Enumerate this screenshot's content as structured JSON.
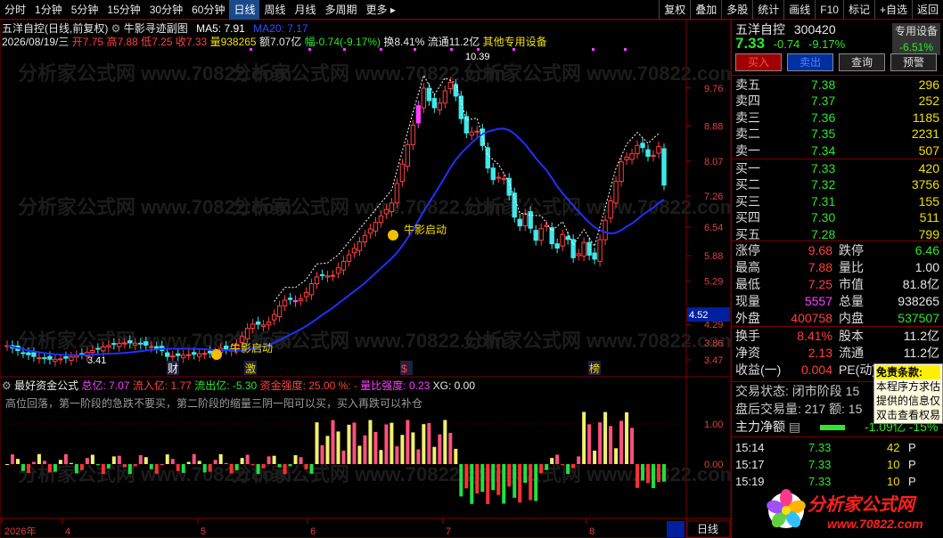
{
  "toolbar": {
    "left": [
      "分时",
      "1分钟",
      "5分钟",
      "15分钟",
      "30分钟",
      "60分钟",
      "日线",
      "周线",
      "月线",
      "多周期",
      "更多 ▸"
    ],
    "right": [
      "复权",
      "叠加",
      "多股",
      "统计",
      "画线",
      "F10",
      "标记",
      "+自选",
      "返回"
    ],
    "active": "日线"
  },
  "header": {
    "title": "五洋自控(日线,前复权)",
    "indicator_name": "牛影寻迹副图",
    "ma5": "MA5: 7.91",
    "ma20": "MA20: 7.17",
    "info_date": "2026/08/19/三",
    "info_open": "开7.75",
    "info_high": "高7.88",
    "info_low": "低7.25",
    "info_close": "收7.33",
    "info_vol": "量938265",
    "info_amt": "额7.07亿",
    "info_chg": "幅-0.74(-9.17%)",
    "info_turn": "换8.41%",
    "info_float": "流通11.2亿",
    "info_tag": "其他专用设备"
  },
  "price_axis": [
    "9.76",
    "8.88",
    "8.07",
    "7.26",
    "6.54",
    "5.88",
    "5.29",
    "4.29",
    "3.86",
    "3.47"
  ],
  "current_price_tag": "4.52",
  "annotations": {
    "high": "10.39",
    "low": "3.41",
    "signal1": "牛影启动",
    "signal2": "牛影启动",
    "events": [
      "财",
      "激",
      "$",
      "榜"
    ]
  },
  "sub": {
    "name": "最好资金公式",
    "total": "总亿: 7.07",
    "inflow": "流入亿: 1.77",
    "outflow": "流出亿: -5.30",
    "strength": "资金强度: 25.00 %: -",
    "vol_ratio": "量比强度: 0.23",
    "xg": "XG: 0.00",
    "note": "高位回落，第一阶段的急跌不要买，第二阶段的缩量三阴一阳可以买，买入再跌可以补仓",
    "axis": [
      "1.00",
      "0.00"
    ]
  },
  "date_axis": [
    "2026年",
    "4",
    "5",
    "6",
    "7",
    "8"
  ],
  "period_label": "日线",
  "watermark": "分析家公式网 www.70822.com",
  "side": {
    "name": "五洋自控",
    "code": "300420",
    "sector_badge": "专用设备",
    "price": "7.33",
    "change": "-0.74",
    "change_pct": "-9.17%",
    "sector_pct": "-6.51%",
    "buttons": [
      "买入",
      "卖出",
      "查询",
      "预警"
    ],
    "asks": [
      {
        "label": "卖五",
        "price": "7.38",
        "vol": "296"
      },
      {
        "label": "卖四",
        "price": "7.37",
        "vol": "252"
      },
      {
        "label": "卖三",
        "price": "7.36",
        "vol": "1185"
      },
      {
        "label": "卖二",
        "price": "7.35",
        "vol": "2231"
      },
      {
        "label": "卖一",
        "price": "7.34",
        "vol": "507"
      }
    ],
    "bids": [
      {
        "label": "买一",
        "price": "7.33",
        "vol": "420"
      },
      {
        "label": "买二",
        "price": "7.32",
        "vol": "3756"
      },
      {
        "label": "买三",
        "price": "7.31",
        "vol": "155"
      },
      {
        "label": "买四",
        "price": "7.30",
        "vol": "511"
      },
      {
        "label": "买五",
        "price": "7.28",
        "vol": "799"
      }
    ],
    "stats": [
      {
        "l1": "涨停",
        "v1": "9.68",
        "l2": "跌停",
        "v2": "6.46"
      },
      {
        "l1": "最高",
        "v1": "7.88",
        "l2": "量比",
        "v2": "1.00"
      },
      {
        "l1": "最低",
        "v1": "7.25",
        "l2": "市值",
        "v2": "81.8亿"
      },
      {
        "l1": "现量",
        "v1": "5557",
        "l2": "总量",
        "v2": "938265"
      },
      {
        "l1": "外盘",
        "v1": "400758",
        "l2": "内盘",
        "v2": "537507"
      }
    ],
    "stats2": [
      {
        "l1": "换手",
        "v1": "8.41%",
        "l2": "股本",
        "v2": "11.2亿"
      },
      {
        "l1": "净资",
        "v1": "2.13",
        "l2": "流通",
        "v2": "11.2亿"
      },
      {
        "l1": "收益(一)",
        "v1": "0.004",
        "l2": "PE(动)",
        "v2": ""
      }
    ],
    "status": "交易状态: 闭市阶段 15",
    "after_hours": "盘后交易量: 217  额: 15",
    "net_label": "主力净额",
    "net_value": "-1.09亿 -15%",
    "ticks": [
      {
        "time": "15:14",
        "price": "7.33",
        "vol": "42",
        "flag": "P"
      },
      {
        "time": "15:17",
        "price": "7.33",
        "vol": "10",
        "flag": "P"
      },
      {
        "time": "15:19",
        "price": "7.33",
        "vol": "10",
        "flag": "P"
      }
    ],
    "tooltip": [
      "免责条款:",
      "本程序方求估",
      "提供的信息仅",
      "双击查看权易"
    ],
    "logo_text": "分析家公式网",
    "logo_url": "www.70822.com"
  }
}
